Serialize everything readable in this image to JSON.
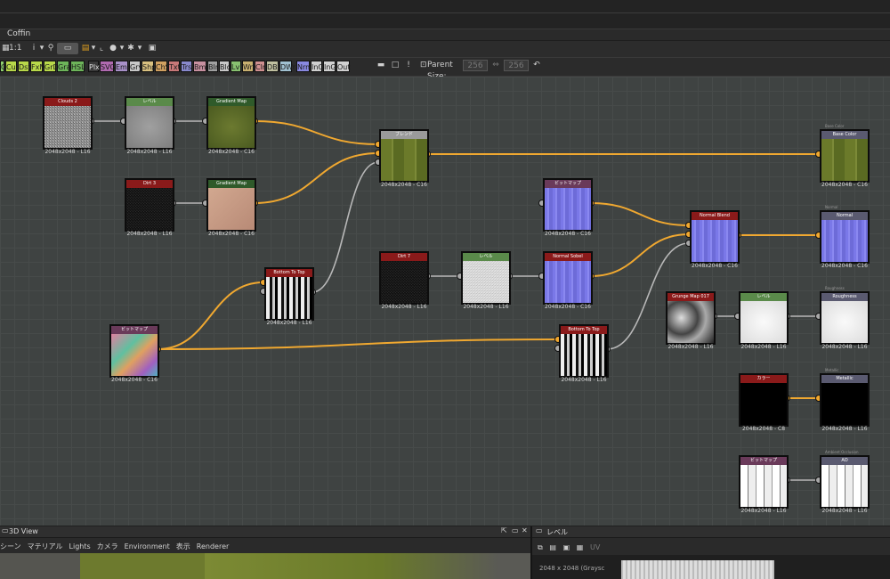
{
  "window": {
    "title": "Coffin"
  },
  "toolbar1": {
    "zoom_label": "1:1"
  },
  "toolbar2": {
    "chips": [
      {
        "label": "G",
        "color": "#8fd070"
      },
      {
        "label": "Cur",
        "color": "#b8d84a"
      },
      {
        "label": "Dst",
        "color": "#b8d84a"
      },
      {
        "label": "FxM",
        "color": "#b8d84a"
      },
      {
        "label": "GrD",
        "color": "#b8d84a"
      },
      {
        "label": "Gra",
        "color": "#6db45a"
      },
      {
        "label": "HSL",
        "color": "#6db45a"
      },
      {
        "label": "Plx",
        "color": "#3a3a3a"
      },
      {
        "label": "SVG",
        "color": "#b06ab0"
      },
      {
        "label": "Emb",
        "color": "#a890c8"
      },
      {
        "label": "Gry",
        "color": "#c8c8c8"
      },
      {
        "label": "Shp",
        "color": "#d8c080"
      },
      {
        "label": "ChS",
        "color": "#d0a060"
      },
      {
        "label": "Txt",
        "color": "#c87878"
      },
      {
        "label": "Trs",
        "color": "#8888cc"
      },
      {
        "label": "Bmp",
        "color": "#c890a0"
      },
      {
        "label": "Blr",
        "color": "#a0a0a0"
      },
      {
        "label": "Bld",
        "color": "#c8c8c8"
      },
      {
        "label": "Lvl",
        "color": "#88c070"
      },
      {
        "label": "Wrp",
        "color": "#c8b070"
      },
      {
        "label": "Clr",
        "color": "#d09090"
      },
      {
        "label": "DBl",
        "color": "#c0c0a0"
      },
      {
        "label": "DWr",
        "color": "#a0c0d0"
      },
      {
        "label": "Nrm",
        "color": "#8888e0"
      },
      {
        "label": "InC",
        "color": "#d0d0d0"
      },
      {
        "label": "InG",
        "color": "#d0d0d0"
      },
      {
        "label": "Out",
        "color": "#d0d0d0"
      }
    ],
    "parent_size_label": "Parent Size:",
    "parent_size_w": "256",
    "parent_size_h": "256"
  },
  "nodes": [
    {
      "id": "n1",
      "title": "Clouds 2",
      "color": "#8a1a1a",
      "label": "2048x2048 - L16",
      "thumb": "noise"
    },
    {
      "id": "n2",
      "title": "レベル",
      "color": "#5a8a4a",
      "label": "2048x2048 - L16",
      "thumb": "gray"
    },
    {
      "id": "n3",
      "title": "Gradient Map",
      "color": "#2f5a2a",
      "label": "2048x2048 - C16",
      "thumb": "green"
    },
    {
      "id": "n4",
      "title": "Dirt 3",
      "color": "#8a1a1a",
      "label": "2048x2048 - L16",
      "thumb": "darknoise"
    },
    {
      "id": "n5",
      "title": "Gradient Map",
      "color": "#2f5a2a",
      "label": "2048x2048 - C16",
      "thumb": "skin"
    },
    {
      "id": "n6",
      "title": "ブレンド",
      "color": "#9a9a9a",
      "label": "2048x2048 - C16",
      "thumb": "wood"
    },
    {
      "id": "n7",
      "title": "Base Color",
      "color": "#5a5a70",
      "label": "2048x2048 - C16",
      "thumb": "wood",
      "tag": "Base Color"
    },
    {
      "id": "n8",
      "title": "ビットマップ",
      "color": "#6a3a5a",
      "label": "2048x2048 - C16",
      "thumb": "normal"
    },
    {
      "id": "n9",
      "title": "Normal Blend",
      "color": "#8a1a1a",
      "label": "2048x2048 - C16",
      "thumb": "normal"
    },
    {
      "id": "n10",
      "title": "Normal",
      "color": "#5a5a70",
      "label": "2048x2048 - C16",
      "thumb": "normal",
      "tag": "Normal"
    },
    {
      "id": "n11",
      "title": "Bottom To Top",
      "color": "#8a1a1a",
      "label": "2048x2048 - L16",
      "thumb": "bars"
    },
    {
      "id": "n12",
      "title": "Dirt 7",
      "color": "#8a1a1a",
      "label": "2048x2048 - L16",
      "thumb": "darknoise"
    },
    {
      "id": "n13",
      "title": "レベル",
      "color": "#5a8a4a",
      "label": "2048x2048 - L16",
      "thumb": "lightnoise"
    },
    {
      "id": "n14",
      "title": "Normal Sobel",
      "color": "#8a1a1a",
      "label": "2048x2048 - C16",
      "thumb": "normal"
    },
    {
      "id": "n15",
      "title": "Grunge Map 017",
      "color": "#8a1a1a",
      "label": "2048x2048 - L16",
      "thumb": "grunge"
    },
    {
      "id": "n16",
      "title": "レベル",
      "color": "#5a8a4a",
      "label": "2048x2048 - L16",
      "thumb": "white"
    },
    {
      "id": "n17",
      "title": "Roughness",
      "color": "#5a5a70",
      "label": "2048x2048 - L16",
      "thumb": "white",
      "tag": "Roughness"
    },
    {
      "id": "n18",
      "title": "ビットマップ",
      "color": "#6a3a5a",
      "label": "2048x2048 - C16",
      "thumb": "colors"
    },
    {
      "id": "n19",
      "title": "Bottom To Top",
      "color": "#8a1a1a",
      "label": "2048x2048 - L16",
      "thumb": "bars"
    },
    {
      "id": "n20",
      "title": "カラー",
      "color": "#8a1a1a",
      "label": "2048x2048 - C8",
      "thumb": "black"
    },
    {
      "id": "n21",
      "title": "Metallic",
      "color": "#5a5a70",
      "label": "2048x2048 - L16",
      "thumb": "black",
      "tag": "Metallic"
    },
    {
      "id": "n22",
      "title": "ビットマップ",
      "color": "#6a3a5a",
      "label": "2048x2048 - L16",
      "thumb": "planks"
    },
    {
      "id": "n23",
      "title": "AO",
      "color": "#5a5a70",
      "label": "2048x2048 - L16",
      "thumb": "planks",
      "tag": "Ambient Occlusion"
    }
  ],
  "view3d": {
    "title": "3D View",
    "menu": [
      "シーン",
      "マテリアル",
      "Lights",
      "カメラ",
      "Environment",
      "表示",
      "Renderer"
    ]
  },
  "level_panel": {
    "title": "レベル",
    "info": "2048 x 2048 (Graysc",
    "uv_label": "UV"
  }
}
